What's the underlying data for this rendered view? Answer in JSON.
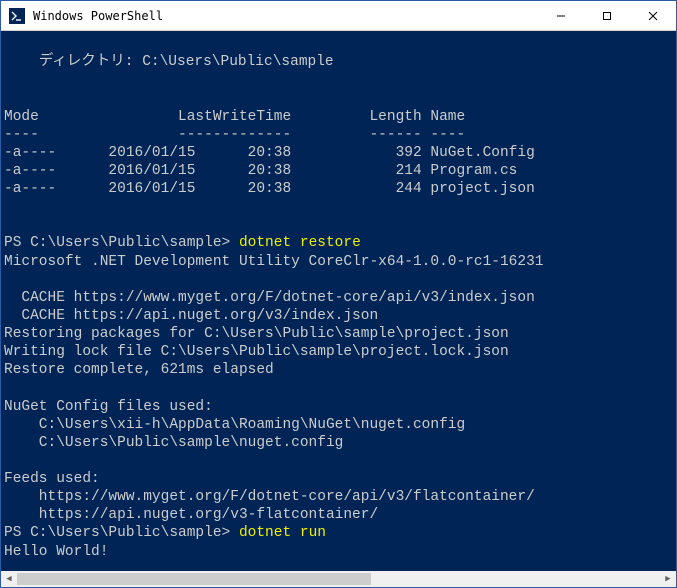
{
  "window": {
    "title": "Windows PowerShell"
  },
  "dir": {
    "heading_prefix": "    ディレクトリ: ",
    "path": "C:\\Users\\Public\\sample",
    "columns": {
      "mode": "Mode",
      "lastwrite": "LastWriteTime",
      "length": "Length",
      "name": "Name"
    },
    "separators": {
      "mode": "----",
      "lastwrite": "-------------",
      "length": "------",
      "name": "----"
    },
    "rows": [
      {
        "mode": "-a----",
        "date": "2016/01/15",
        "time": "20:38",
        "length": "392",
        "name": "NuGet.Config"
      },
      {
        "mode": "-a----",
        "date": "2016/01/15",
        "time": "20:38",
        "length": "214",
        "name": "Program.cs"
      },
      {
        "mode": "-a----",
        "date": "2016/01/15",
        "time": "20:38",
        "length": "244",
        "name": "project.json"
      }
    ]
  },
  "session": {
    "prompt1_prefix": "PS C:\\Users\\Public\\sample> ",
    "cmd1": "dotnet restore",
    "restore_lines": [
      "Microsoft .NET Development Utility CoreClr-x64-1.0.0-rc1-16231",
      "",
      "  CACHE https://www.myget.org/F/dotnet-core/api/v3/index.json",
      "  CACHE https://api.nuget.org/v3/index.json",
      "Restoring packages for C:\\Users\\Public\\sample\\project.json",
      "Writing lock file C:\\Users\\Public\\sample\\project.lock.json",
      "Restore complete, 621ms elapsed",
      "",
      "NuGet Config files used:",
      "    C:\\Users\\xii-h\\AppData\\Roaming\\NuGet\\nuget.config",
      "    C:\\Users\\Public\\sample\\nuget.config",
      "",
      "Feeds used:",
      "    https://www.myget.org/F/dotnet-core/api/v3/flatcontainer/",
      "    https://api.nuget.org/v3-flatcontainer/"
    ],
    "prompt2_prefix": "PS C:\\Users\\Public\\sample> ",
    "cmd2": "dotnet run",
    "run_output": "Hello World!"
  }
}
